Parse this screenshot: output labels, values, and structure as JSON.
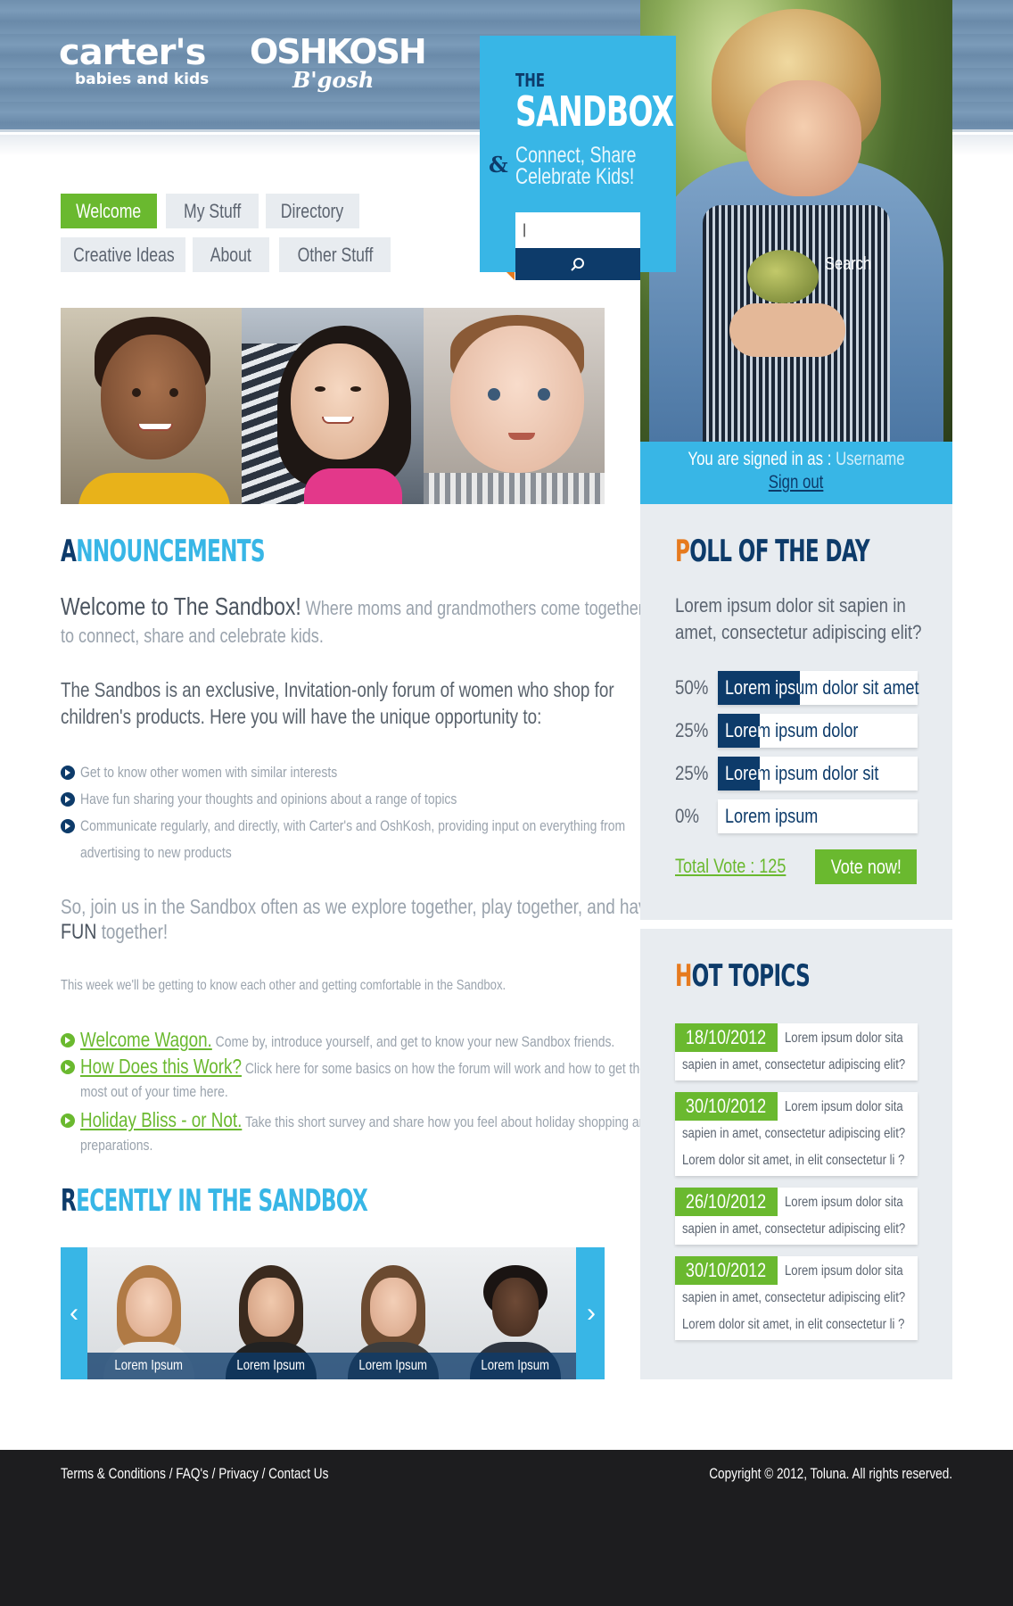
{
  "brand": {
    "carters": "carter's",
    "carters_sub": "babies and kids",
    "oshkosh": "OSHKOSH",
    "oshkosh_sub": "B'gosh"
  },
  "sandbox": {
    "the": "THE",
    "title": "SANDBOX",
    "amp": "&",
    "tagline_1": "Connect, Share",
    "tagline_2": "Celebrate Kids!",
    "search_value": "|",
    "search_label": "Search"
  },
  "nav": {
    "items": [
      {
        "label": "Welcome",
        "active": true
      },
      {
        "label": "My Stuff"
      },
      {
        "label": "Directory"
      },
      {
        "label": "Creative Ideas"
      },
      {
        "label": "About"
      },
      {
        "label": "Other Stuff"
      }
    ]
  },
  "account": {
    "signed_prefix": "You are signed in as : ",
    "username": "Username",
    "sign_out": "Sign out"
  },
  "announcements": {
    "heading_first": "A",
    "heading_rest": "NNOUNCEMENTS",
    "welcome_lead": "Welcome to The Sandbox!",
    "welcome_rest_1": "Where moms and grandmothers come together",
    "welcome_rest_2": "to connect, share and celebrate kids.",
    "intro_1": "The Sandbos is an exclusive, Invitation-only forum of women who shop for",
    "intro_2": "children's products. Here you will have the unique opportunity to:",
    "bullets": [
      "Get to know other women with similar interests",
      "Have fun sharing your thoughts and opinions about a range of topics",
      "Communicate regularly, and directly, with Carter's and OshKosh, providing input on everything from",
      "advertising to new products"
    ],
    "join_1": "So, join us in the Sandbox often as we explore together, play together, and have",
    "join_fun": "FUN",
    "join_2": " together!",
    "week_note": "This week we'll be getting to know each other and getting comfortable in the Sandbox.",
    "links": [
      {
        "title": "Welcome Wagon.",
        "desc": " Come by, introduce yourself, and get to know your new Sandbox friends."
      },
      {
        "title": "How Does this Work?",
        "desc": " Click here for some basics on how the forum will work and how to get the",
        "desc_2": "most out of your time here."
      },
      {
        "title": "Holiday Bliss - or Not.",
        "desc": " Take this short survey and share how you feel about holiday shopping and",
        "desc_2": "preparations."
      }
    ]
  },
  "recent": {
    "heading_first": "R",
    "heading_rest": "ECENTLY IN THE SANDBOX",
    "people": [
      "Lorem Ipsum",
      "Lorem Ipsum",
      "Lorem Ipsum",
      "Lorem Ipsum"
    ],
    "prev": "‹",
    "next": "›"
  },
  "poll": {
    "heading_first": "P",
    "heading_rest": "OLL OF THE DAY",
    "question_1": "Lorem ipsum dolor sit sapien in",
    "question_2": "amet, consectetur adipiscing elit?",
    "options": [
      {
        "pct": "50%",
        "fraction": 0.41,
        "label": "Lorem ipsum dolor sit amet"
      },
      {
        "pct": "25%",
        "fraction": 0.21,
        "label": "Lorem ipsum dolor"
      },
      {
        "pct": "25%",
        "fraction": 0.21,
        "label": "Lorem ipsum dolor sit"
      },
      {
        "pct": "0%",
        "fraction": 0.0,
        "label": "Lorem ipsum"
      }
    ],
    "total": "Total Vote : 125",
    "vote_button": "Vote now!"
  },
  "hot_topics": {
    "heading_first": "H",
    "heading_rest": "OT TOPICS",
    "items": [
      {
        "date": "18/10/2012",
        "line1": "Lorem ipsum dolor sita",
        "line2": "sapien in amet, consectetur adipiscing elit?",
        "line3": ""
      },
      {
        "date": "30/10/2012",
        "line1": "Lorem ipsum dolor sita",
        "line2": "sapien in amet, consectetur adipiscing elit?",
        "line3": "Lorem dolor sit amet, in elit consectetur li ?"
      },
      {
        "date": "26/10/2012",
        "line1": "Lorem ipsum dolor sita",
        "line2": "sapien in amet, consectetur adipiscing elit?",
        "line3": ""
      },
      {
        "date": "30/10/2012",
        "line1": "Lorem ipsum dolor sita",
        "line2": "sapien in amet, consectetur adipiscing elit?",
        "line3": "Lorem dolor sit amet, in elit consectetur li ?"
      }
    ]
  },
  "footer": {
    "links": [
      "Terms & Conditions",
      "FAQ's",
      "Privacy",
      "Contact Us"
    ],
    "separator": " / ",
    "copyright": "Copyright © 2012, Toluna. All rights reserved."
  },
  "colors": {
    "accent_blue": "#38b6e6",
    "navy": "#0d3b6a",
    "green": "#6ab92f",
    "orange": "#e67a1e"
  }
}
